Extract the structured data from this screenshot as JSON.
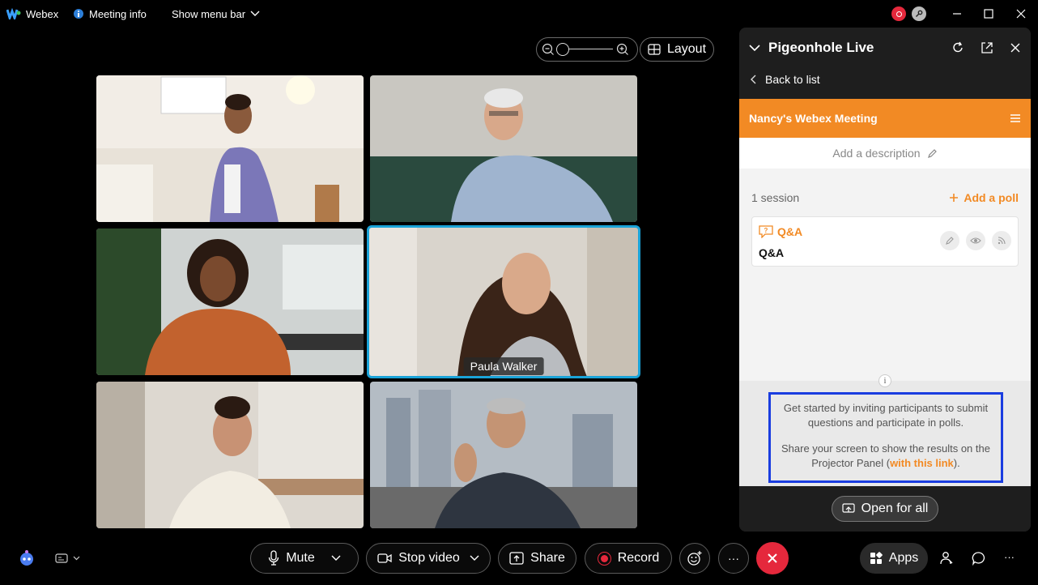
{
  "topbar": {
    "app_name": "Webex",
    "meeting_info": "Meeting info",
    "show_menu": "Show menu bar"
  },
  "view": {
    "layout_label": "Layout"
  },
  "participants": [
    {
      "name": ""
    },
    {
      "name": ""
    },
    {
      "name": ""
    },
    {
      "name": "Paula Walker"
    },
    {
      "name": ""
    },
    {
      "name": ""
    }
  ],
  "panel": {
    "title": "Pigeonhole Live",
    "back": "Back to list",
    "meeting_name": "Nancy's Webex Meeting",
    "add_description": "Add a description",
    "session_count": "1 session",
    "add_poll": "Add a poll",
    "session": {
      "type": "Q&A",
      "name": "Q&A"
    },
    "info_text_1": "Get started by inviting participants to submit questions and participate in polls.",
    "info_text_2a": "Share your screen to show the results on the Projector Panel (",
    "info_link": "with this link",
    "info_text_2b": ").",
    "open_for_all": "Open for all"
  },
  "toolbar": {
    "mute": "Mute",
    "stop_video": "Stop video",
    "share": "Share",
    "record": "Record",
    "more": "···",
    "apps": "Apps",
    "overflow": "···"
  },
  "colors": {
    "accent": "#f28a24",
    "active_border": "#1aa3d8",
    "end_call": "#e5283c",
    "highlight": "#1a3de0"
  }
}
